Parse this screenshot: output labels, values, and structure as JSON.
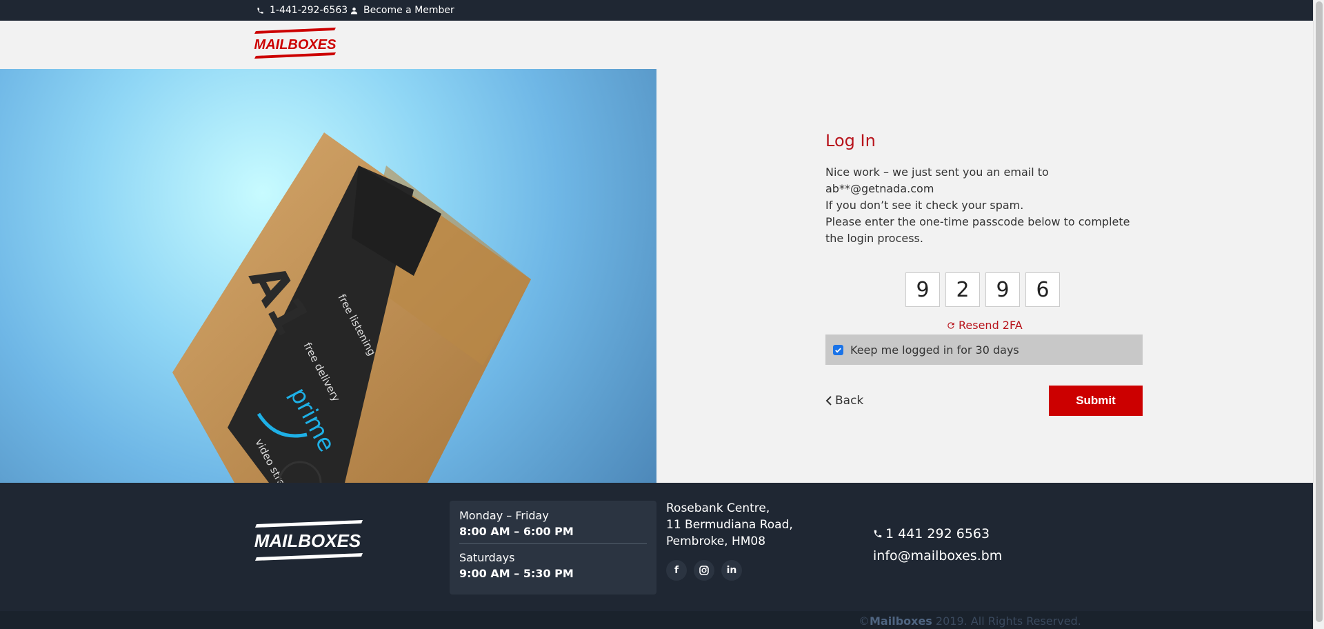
{
  "topbar": {
    "phone": "1-441-292-6563",
    "member_link": "Become a Member"
  },
  "header": {
    "logo_text": "MAILBOXES"
  },
  "login": {
    "title": "Log In",
    "line1": "Nice work – we just sent you an email to",
    "line2": "ab**@getnada.com",
    "line3": "If you don’t see it check your spam.",
    "line4": "Please enter the one-time passcode below to complete the login process.",
    "otp": [
      "9",
      "2",
      "9",
      "6"
    ],
    "resend_label": "Resend 2FA",
    "keep_label": "Keep me logged in for 30 days",
    "keep_checked": true,
    "back_label": "Back",
    "submit_label": "Submit"
  },
  "footer": {
    "logo_text": "MAILBOXES",
    "hours": {
      "weekday_label": "Monday – Friday",
      "weekday_time": "8:00 AM – 6:00 PM",
      "saturday_label": "Saturdays",
      "saturday_time": "9:00 AM – 5:30 PM"
    },
    "address": {
      "line1": "Rosebank Centre,",
      "line2": "11 Bermudiana Road,",
      "line3": "Pembroke, HM08"
    },
    "social": [
      "facebook-icon",
      "instagram-icon",
      "linkedin-icon"
    ],
    "phone": "1 441 292 6563",
    "email": "info@mailboxes.bm",
    "copyright_prefix": "©",
    "copyright_brand": "Mailboxes",
    "copyright_suffix": " 2019. All Rights Reserved."
  },
  "colors": {
    "brand_red": "#cc0000",
    "title_red": "#b8141c",
    "dark_navy": "#1f2733"
  }
}
